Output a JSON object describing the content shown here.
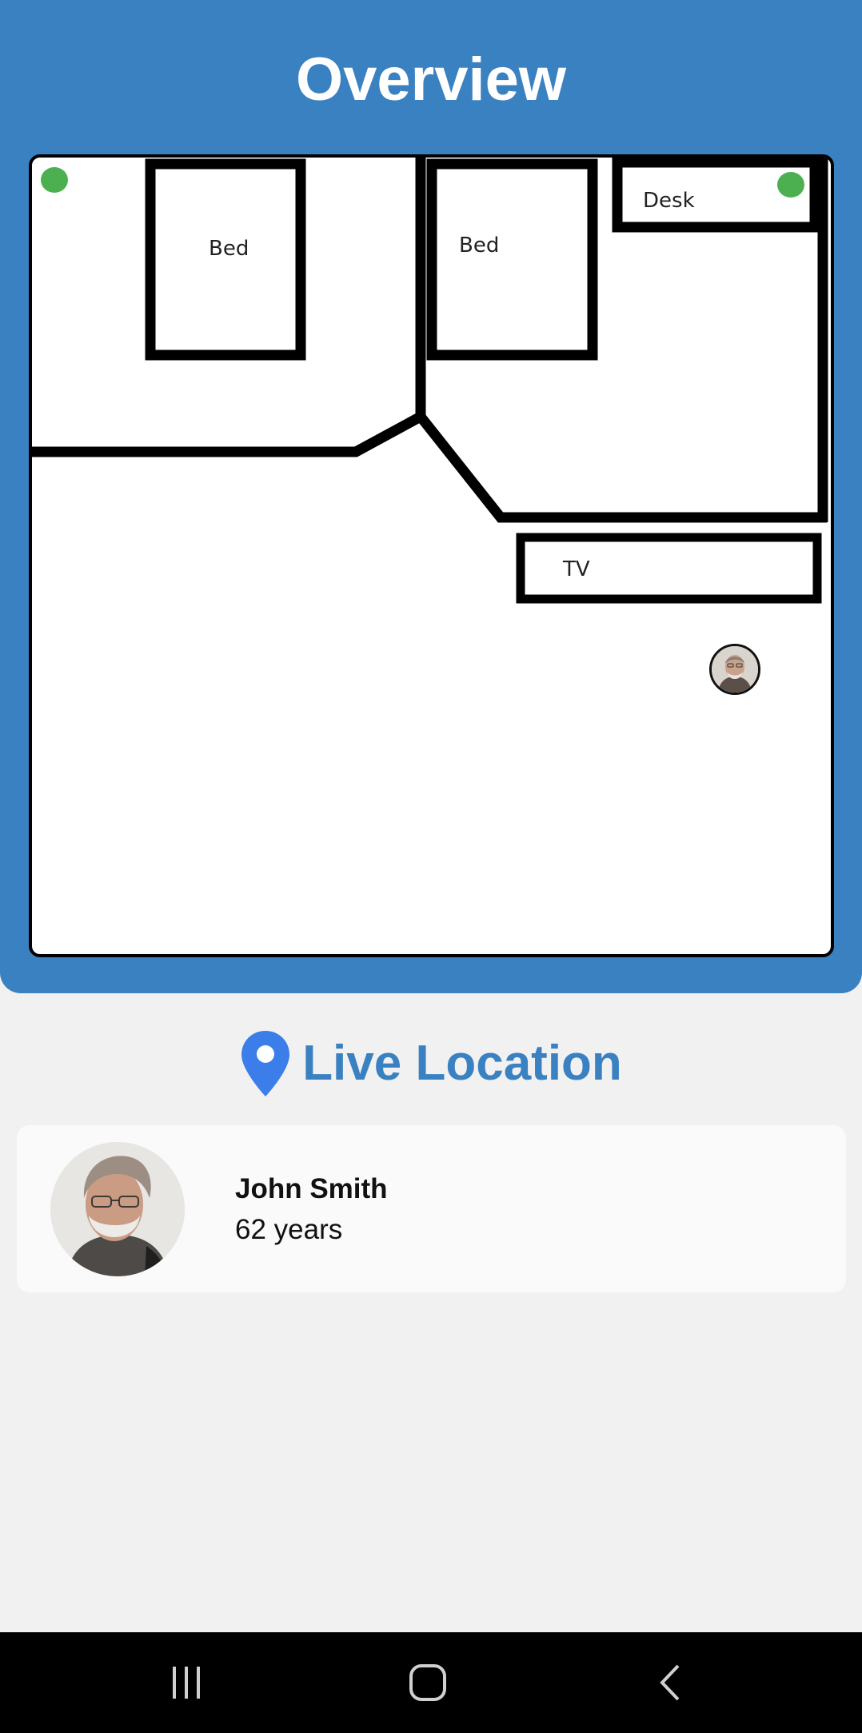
{
  "header": {
    "title": "Overview",
    "background_color": "#3a81c1"
  },
  "floor_plan": {
    "furniture": [
      {
        "label": "Bed"
      },
      {
        "label": "Bed"
      },
      {
        "label": "Desk"
      },
      {
        "label": "TV"
      }
    ],
    "sensor_color": "#4caf50",
    "resident_marker_icon": "person-avatar-icon"
  },
  "live_location": {
    "title": "Live Location",
    "icon": "location-pin-icon",
    "icon_color": "#3b7de9",
    "title_color": "#3a81c1"
  },
  "profile": {
    "name": "John Smith",
    "age": "62 years",
    "avatar_icon": "person-avatar-icon"
  },
  "nav": {
    "recents_icon": "recent-apps-icon",
    "home_icon": "home-icon",
    "back_icon": "back-icon"
  }
}
